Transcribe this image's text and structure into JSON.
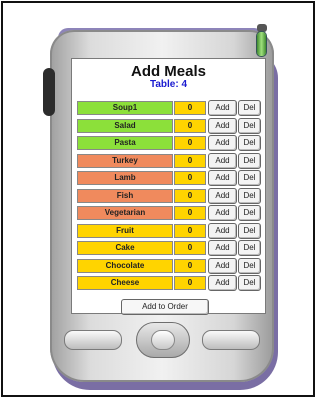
{
  "screen": {
    "title": "Add Meals",
    "table_label": "Table: 4"
  },
  "colors": {
    "green": "#8ce03a",
    "salmon": "#f08a5d",
    "yellow": "#ffd400"
  },
  "meals": [
    {
      "name": "Soup1",
      "qty": "0",
      "color": "green"
    },
    {
      "name": "Salad",
      "qty": "0",
      "color": "green"
    },
    {
      "name": "Pasta",
      "qty": "0",
      "color": "green"
    },
    {
      "name": "Turkey",
      "qty": "0",
      "color": "salmon"
    },
    {
      "name": "Lamb",
      "qty": "0",
      "color": "salmon"
    },
    {
      "name": "Fish",
      "qty": "0",
      "color": "salmon"
    },
    {
      "name": "Vegetarian",
      "qty": "0",
      "color": "salmon"
    },
    {
      "name": "Fruit",
      "qty": "0",
      "color": "yellow"
    },
    {
      "name": "Cake",
      "qty": "0",
      "color": "yellow"
    },
    {
      "name": "Chocolate",
      "qty": "0",
      "color": "yellow"
    },
    {
      "name": "Cheese",
      "qty": "0",
      "color": "yellow"
    }
  ],
  "buttons": {
    "add_label": "Add",
    "del_label": "Del",
    "add_to_order_label": "Add to Order"
  },
  "icons": {
    "side_knob": "scroll-wheel-icon",
    "power_led": "power-indicator-icon",
    "dpad": "directional-pad-icon"
  }
}
